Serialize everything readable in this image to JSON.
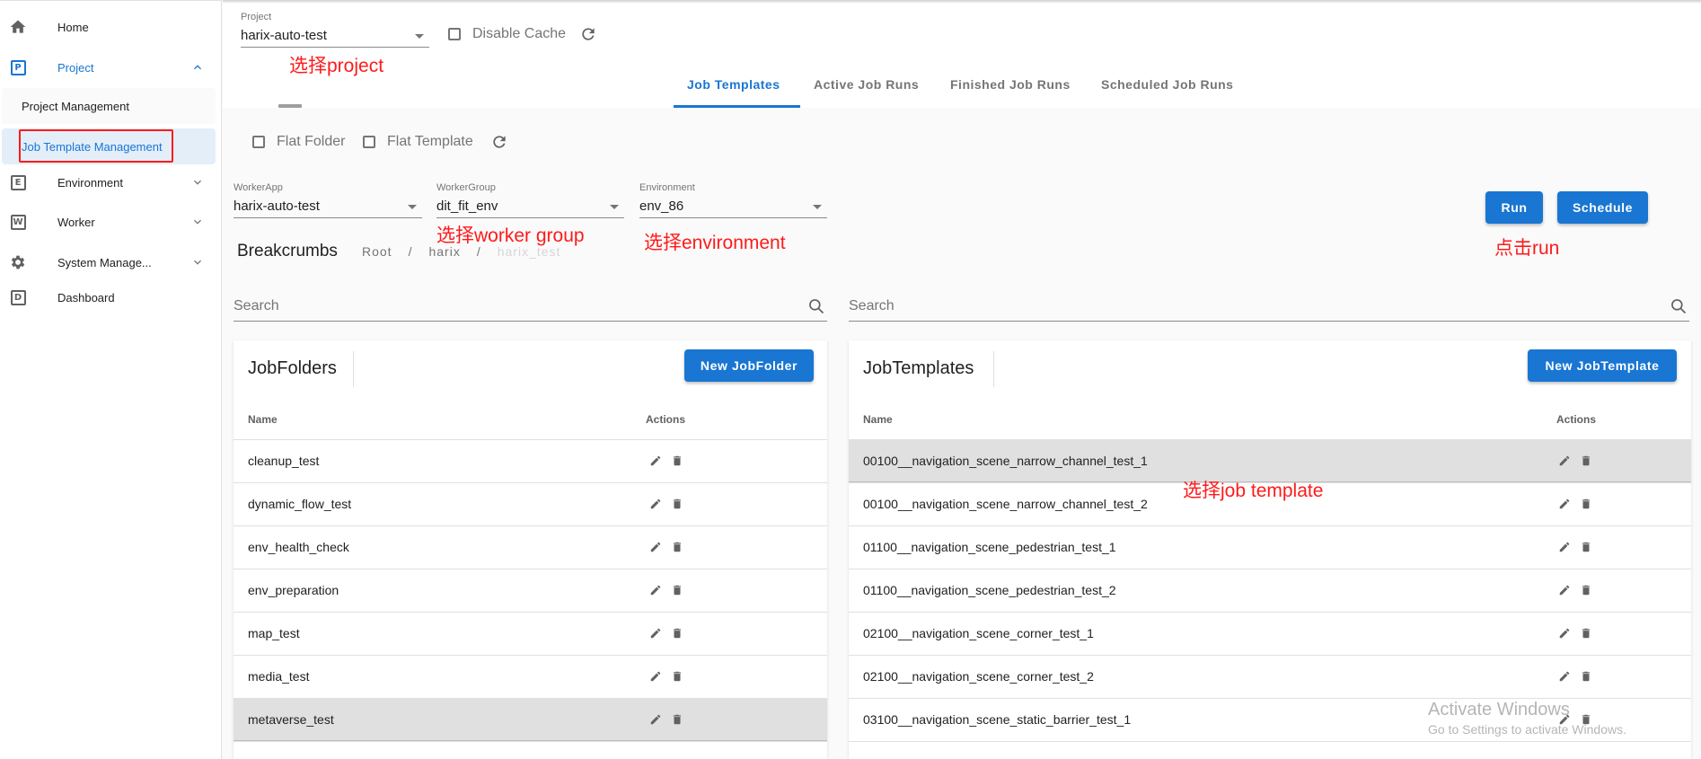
{
  "sidebar": {
    "items": [
      {
        "label": "Home",
        "icon": "home-icon"
      },
      {
        "label": "Project",
        "icon": "project-icon",
        "icon_letter": "P",
        "expanded": true
      },
      {
        "label": "Environment",
        "icon": "environment-icon",
        "icon_letter": "E"
      },
      {
        "label": "Worker",
        "icon": "worker-icon",
        "icon_letter": "W"
      },
      {
        "label": "System Manage...",
        "icon": "gear-icon"
      },
      {
        "label": "Dashboard",
        "icon": "dashboard-icon",
        "icon_letter": "D"
      }
    ],
    "project_children": [
      {
        "label": "Project Management"
      },
      {
        "label": "Job Template Management",
        "selected": true
      }
    ]
  },
  "header": {
    "project_label": "Project",
    "project_value": "harix-auto-test",
    "disable_cache_label": "Disable Cache",
    "disable_cache_checked": false
  },
  "tabs": [
    {
      "label": "Job Templates",
      "active": true
    },
    {
      "label": "Active Job Runs"
    },
    {
      "label": "Finished Job Runs"
    },
    {
      "label": "Scheduled Job Runs"
    }
  ],
  "filters": {
    "flat_folder_label": "Flat Folder",
    "flat_template_label": "Flat Template",
    "worker_app_label": "WorkerApp",
    "worker_app_value": "harix-auto-test",
    "worker_group_label": "WorkerGroup",
    "worker_group_value": "dit_fit_env",
    "environment_label": "Environment",
    "environment_value": "env_86"
  },
  "actions": {
    "run_label": "Run",
    "schedule_label": "Schedule"
  },
  "breadcrumbs": {
    "title": "Breakcrumbs",
    "items": [
      "Root",
      "harix",
      "harix_test"
    ],
    "separator": "/"
  },
  "annotations": {
    "select_project": "选择project",
    "select_worker_group": "选择worker group",
    "select_environment": "选择environment",
    "click_run": "点击run",
    "select_job_template": "选择job template"
  },
  "folders_panel": {
    "search_placeholder": "Search",
    "title": "JobFolders",
    "new_button": "New JobFolder",
    "col_name": "Name",
    "col_actions": "Actions",
    "rows": [
      {
        "name": "cleanup_test"
      },
      {
        "name": "dynamic_flow_test"
      },
      {
        "name": "env_health_check"
      },
      {
        "name": "env_preparation"
      },
      {
        "name": "map_test"
      },
      {
        "name": "media_test"
      },
      {
        "name": "metaverse_test",
        "selected": true
      }
    ]
  },
  "templates_panel": {
    "search_placeholder": "Search",
    "title": "JobTemplates",
    "new_button": "New JobTemplate",
    "col_name": "Name",
    "col_actions": "Actions",
    "rows": [
      {
        "name": "00100__navigation_scene_narrow_channel_test_1",
        "selected": true
      },
      {
        "name": "00100__navigation_scene_narrow_channel_test_2"
      },
      {
        "name": "01100__navigation_scene_pedestrian_test_1"
      },
      {
        "name": "01100__navigation_scene_pedestrian_test_2"
      },
      {
        "name": "02100__navigation_scene_corner_test_1"
      },
      {
        "name": "02100__navigation_scene_corner_test_2"
      },
      {
        "name": "03100__navigation_scene_static_barrier_test_1"
      }
    ]
  },
  "watermark": {
    "line1": "Activate Windows",
    "line2": "Go to Settings to activate Windows."
  },
  "colors": {
    "accent": "#1976d2",
    "annotation": "#ff1a1a",
    "selected_row": "#e0e0e0",
    "selected_nav_bg": "#e3eef9"
  }
}
